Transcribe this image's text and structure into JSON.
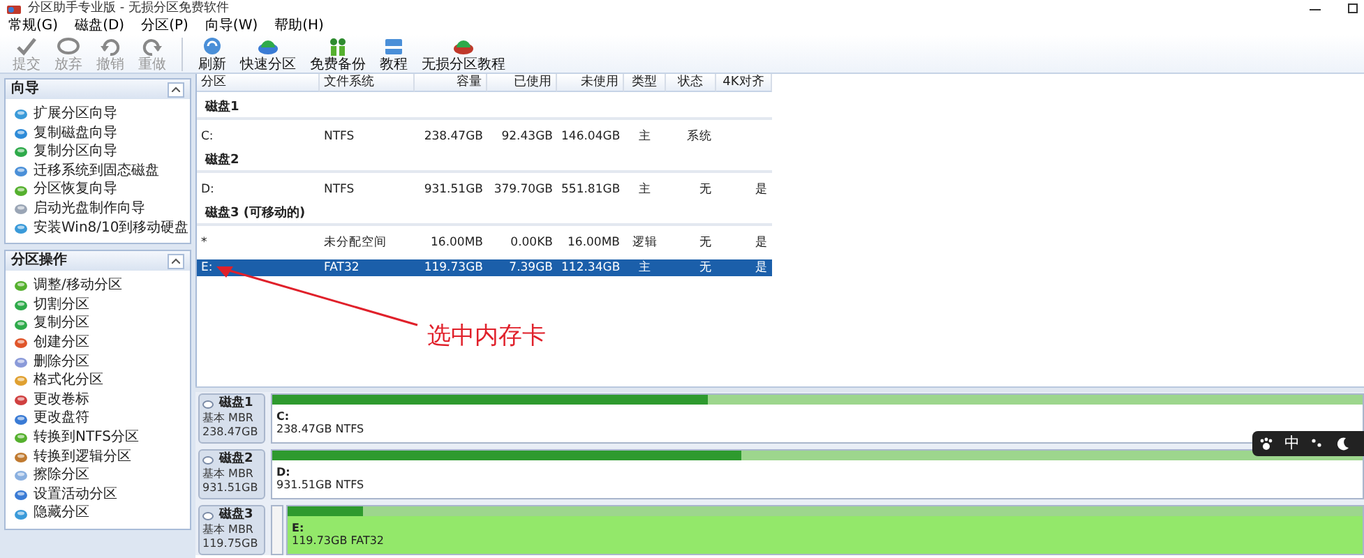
{
  "window": {
    "title": "分区助手专业版 - 无损分区免费软件"
  },
  "menu": [
    "常规(G)",
    "磁盘(D)",
    "分区(P)",
    "向导(W)",
    "帮助(H)"
  ],
  "toolbar": [
    {
      "label": "提交",
      "disabled": true
    },
    {
      "label": "放弃",
      "disabled": true
    },
    {
      "label": "撤销",
      "disabled": true
    },
    {
      "label": "重做",
      "disabled": true
    },
    {
      "label": "刷新",
      "disabled": false
    },
    {
      "label": "快速分区",
      "disabled": false
    },
    {
      "label": "免费备份",
      "disabled": false
    },
    {
      "label": "教程",
      "disabled": false
    },
    {
      "label": "无损分区教程",
      "disabled": false
    }
  ],
  "sidebar": {
    "panels": [
      {
        "title": "向导",
        "expanded": true,
        "items": [
          "扩展分区向导",
          "复制磁盘向导",
          "复制分区向导",
          "迁移系统到固态磁盘",
          "分区恢复向导",
          "启动光盘制作向导",
          "安装Win8/10到移动硬盘"
        ]
      },
      {
        "title": "分区操作",
        "expanded": true,
        "items": [
          "调整/移动分区",
          "切割分区",
          "复制分区",
          "创建分区",
          "删除分区",
          "格式化分区",
          "更改卷标",
          "更改盘符",
          "转换到NTFS分区",
          "转换到逻辑分区",
          "擦除分区",
          "设置活动分区",
          "隐藏分区"
        ]
      }
    ]
  },
  "table": {
    "columns": [
      "分区",
      "文件系统",
      "容量",
      "已使用",
      "未使用",
      "类型",
      "状态",
      "4K对齐"
    ],
    "groups": [
      {
        "title": "磁盘1",
        "rows": [
          {
            "partition": "C:",
            "file_system": "NTFS",
            "capacity": "238.47GB",
            "used": "92.43GB",
            "free": "146.04GB",
            "type": "主",
            "status": "系统",
            "selected": false
          }
        ]
      },
      {
        "title": "磁盘2",
        "rows": [
          {
            "partition": "D:",
            "file_system": "NTFS",
            "capacity": "931.51GB",
            "used": "379.70GB",
            "free": "551.81GB",
            "type": "主",
            "status": "无",
            "alignment_4k": "是",
            "selected": false
          }
        ]
      },
      {
        "title": "磁盘3 (可移动的)",
        "rows": [
          {
            "partition": "*",
            "file_system": "未分配空间",
            "capacity": "16.00MB",
            "used": "0.00KB",
            "free": "16.00MB",
            "type": "逻辑",
            "status": "无",
            "alignment_4k": "是",
            "selected": false
          },
          {
            "partition": "E:",
            "file_system": "FAT32",
            "capacity": "119.73GB",
            "used": "7.39GB",
            "free": "112.34GB",
            "type": "主",
            "status": "无",
            "alignment_4k": "是",
            "selected": true
          }
        ]
      }
    ]
  },
  "annotation": {
    "text": "选中内存卡"
  },
  "disk_map": [
    {
      "name": "磁盘1",
      "type": "基本 MBR",
      "size": "238.47GB",
      "partitions": [
        {
          "kind": "partition",
          "label": "C:",
          "detail": "238.47GB NTFS",
          "level": 0.4,
          "selected": false
        }
      ]
    },
    {
      "name": "磁盘2",
      "type": "基本 MBR",
      "size": "931.51GB",
      "partitions": [
        {
          "kind": "partition",
          "label": "D:",
          "detail": "931.51GB NTFS",
          "level": 0.43,
          "selected": false
        }
      ]
    },
    {
      "name": "磁盘3",
      "type": "基本 MBR",
      "size": "119.75GB",
      "partitions": [
        {
          "kind": "unallocated",
          "selected": false
        },
        {
          "kind": "partition",
          "label": "E:",
          "detail": "119.73GB FAT32",
          "level": 0.07,
          "selected": true
        }
      ]
    }
  ],
  "ime_toolbar": {
    "mode": "中"
  }
}
